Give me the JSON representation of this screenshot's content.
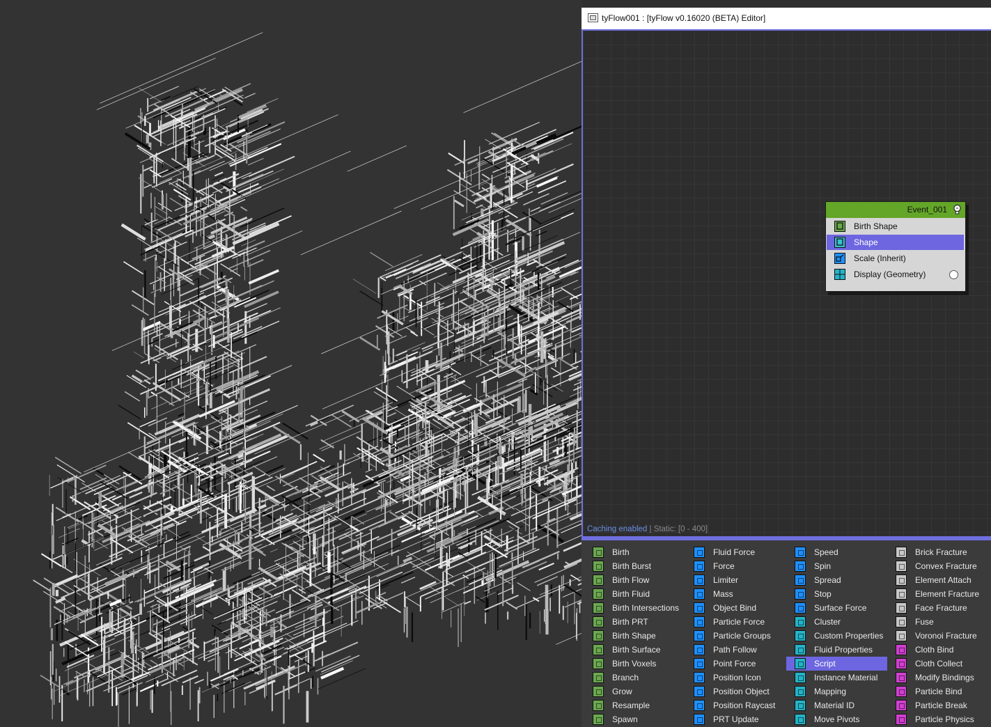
{
  "window": {
    "title": "tyFlow001 : [tyFlow v0.16020 (BETA) Editor]"
  },
  "colors": {
    "accent": "#6f6fe0",
    "event_header": "#63a628",
    "birth": "#6aa84f",
    "force": "#1e90ff",
    "other": "#22b4c8",
    "fracture": "#c8c8c8",
    "physics": "#d040d0"
  },
  "status": {
    "caching": "Caching enabled",
    "separator": "|",
    "static": "Static: [0 - 400]"
  },
  "event": {
    "title": "Event_001",
    "operators": [
      {
        "label": "Birth Shape",
        "icon": "birth-shape-icon",
        "selected": false
      },
      {
        "label": "Shape",
        "icon": "shape-icon",
        "selected": true
      },
      {
        "label": "Scale (Inherit)",
        "icon": "scale-icon",
        "selected": false
      },
      {
        "label": "Display (Geometry)",
        "icon": "display-icon",
        "selected": false
      }
    ]
  },
  "palette": {
    "columns": [
      [
        "Birth",
        "Birth Burst",
        "Birth Flow",
        "Birth Fluid",
        "Birth Intersections",
        "Birth PRT",
        "Birth Shape",
        "Birth Surface",
        "Birth Voxels",
        "Branch",
        "Grow",
        "Resample",
        "Spawn"
      ],
      [
        "Fluid Force",
        "Force",
        "Limiter",
        "Mass",
        "Object Bind",
        "Particle Force",
        "Particle Groups",
        "Path Follow",
        "Point Force",
        "Position Icon",
        "Position Object",
        "Position Raycast",
        "PRT Update"
      ],
      [
        "Speed",
        "Spin",
        "Spread",
        "Stop",
        "Surface Force",
        "Cluster",
        "Custom Properties",
        "Fluid Properties",
        "Script",
        "Instance Material",
        "Mapping",
        "Material ID",
        "Move Pivots"
      ],
      [
        "Brick Fracture",
        "Convex Fracture",
        "Element Attach",
        "Element Fracture",
        "Face Fracture",
        "Fuse",
        "Voronoi Fracture",
        "Cloth Bind",
        "Cloth Collect",
        "Modify Bindings",
        "Particle Bind",
        "Particle Break",
        "Particle Physics"
      ]
    ],
    "selected": "Script"
  }
}
